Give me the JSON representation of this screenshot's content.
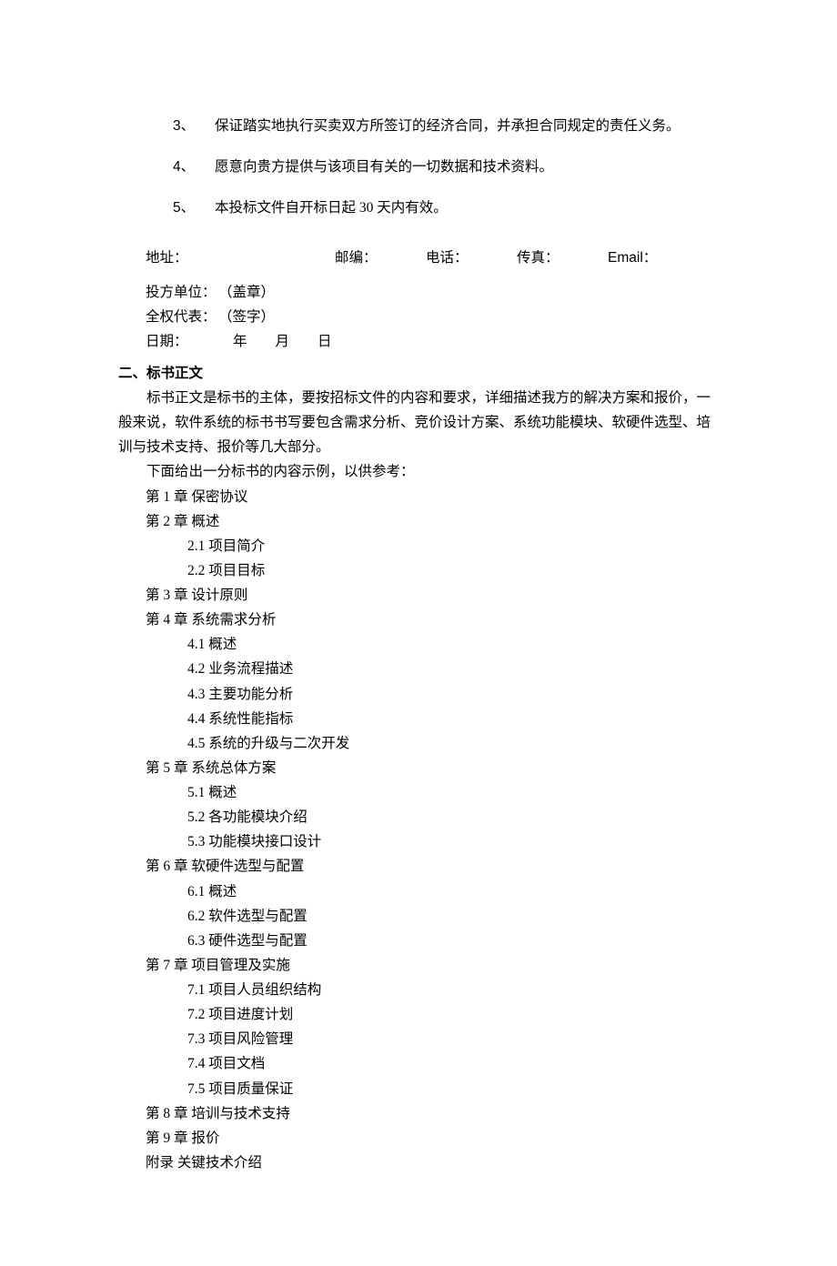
{
  "numbered": [
    {
      "num": "3、",
      "text": "保证踏实地执行买卖双方所签订的经济合同，并承担合同规定的责任义务。"
    },
    {
      "num": "4、",
      "text": "愿意向贵方提供与该项目有关的一切数据和技术资料。"
    },
    {
      "num": "5、",
      "text": "本投标文件自开标日起 30 天内有效。"
    }
  ],
  "contact": {
    "address": "地址：",
    "zip": "邮编：",
    "phone": "电话：",
    "fax": "传真：",
    "email": "Email："
  },
  "sig": {
    "unit_k": "投方单位：",
    "unit_v": "（盖章）",
    "rep_k": "全权代表：",
    "rep_v": "（签字）",
    "date_k": "日期：",
    "date_v": "年　　月　　日"
  },
  "sectionTitle": "二、标书正文",
  "para1": "标书正文是标书的主体，要按招标文件的内容和要求，详细描述我方的解决方案和报价，一般来说，软件系统的标书书写要包含需求分析、竞价设计方案、系统功能模块、软硬件选型、培训与技术支持、报价等几大部分。",
  "para2": "下面给出一分标书的内容示例，以供参考：",
  "toc": [
    {
      "lvl": 1,
      "text": "第 1 章  保密协议"
    },
    {
      "lvl": 1,
      "text": "第 2 章  概述"
    },
    {
      "lvl": 2,
      "text": "2.1  项目简介"
    },
    {
      "lvl": 2,
      "text": "2.2  项目目标"
    },
    {
      "lvl": 1,
      "text": "第 3 章  设计原则"
    },
    {
      "lvl": 1,
      "text": "第 4 章  系统需求分析"
    },
    {
      "lvl": 2,
      "text": "4.1  概述"
    },
    {
      "lvl": 2,
      "text": "4.2 业务流程描述"
    },
    {
      "lvl": 2,
      "text": "4.3  主要功能分析"
    },
    {
      "lvl": 2,
      "text": "4.4  系统性能指标"
    },
    {
      "lvl": 2,
      "text": "4.5  系统的升级与二次开发"
    },
    {
      "lvl": 1,
      "text": "第 5 章  系统总体方案"
    },
    {
      "lvl": 2,
      "text": "5.1  概述"
    },
    {
      "lvl": 2,
      "text": "5.2  各功能模块介绍"
    },
    {
      "lvl": 2,
      "text": "5.3 功能模块接口设计"
    },
    {
      "lvl": 1,
      "text": "第 6 章  软硬件选型与配置"
    },
    {
      "lvl": 2,
      "text": "6.1  概述"
    },
    {
      "lvl": 2,
      "text": "6.2  软件选型与配置"
    },
    {
      "lvl": 2,
      "text": "6.3  硬件选型与配置"
    },
    {
      "lvl": 1,
      "text": "第 7 章  项目管理及实施"
    },
    {
      "lvl": 2,
      "text": "7.1  项目人员组织结构"
    },
    {
      "lvl": 2,
      "text": "7.2  项目进度计划"
    },
    {
      "lvl": 2,
      "text": "7.3  项目风险管理"
    },
    {
      "lvl": 2,
      "text": "7.4  项目文档"
    },
    {
      "lvl": 2,
      "text": "7.5  项目质量保证"
    },
    {
      "lvl": 1,
      "text": "第 8 章  培训与技术支持"
    },
    {
      "lvl": 1,
      "text": "第 9 章  报价"
    },
    {
      "lvl": 1,
      "text": "附录  关键技术介绍"
    }
  ]
}
